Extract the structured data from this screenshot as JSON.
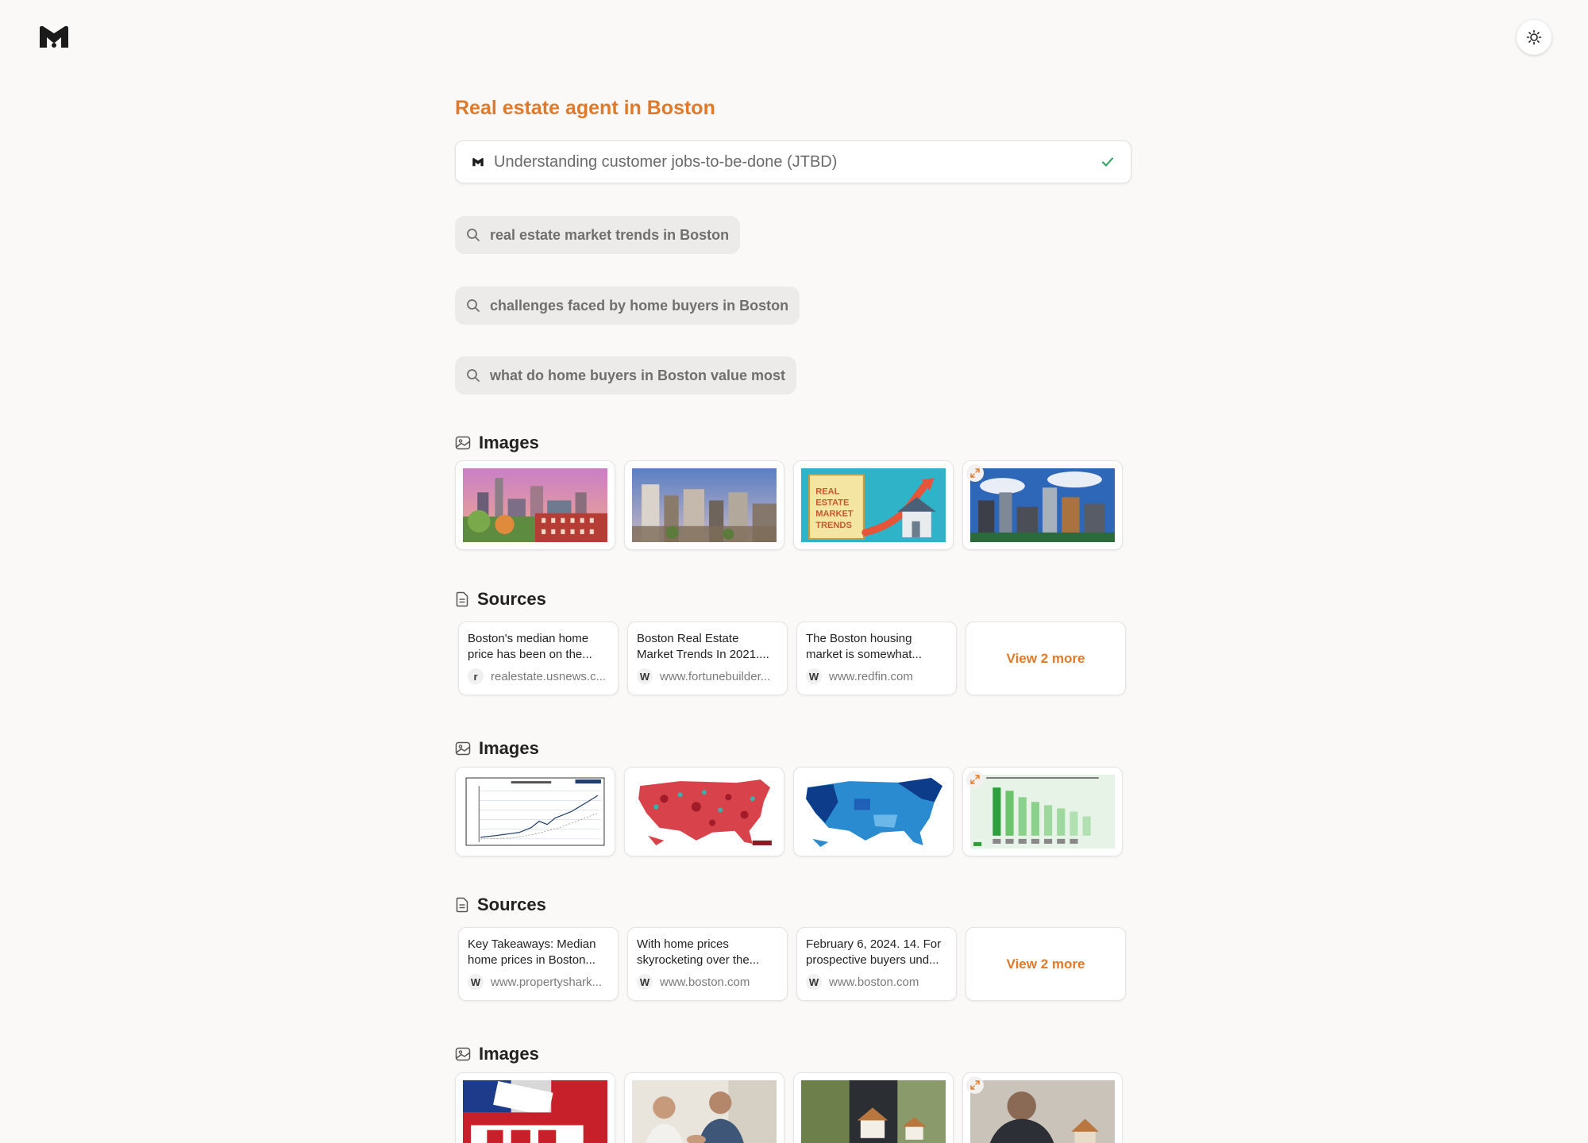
{
  "header": {
    "logo_icon": "m-logo-icon",
    "theme_toggle_icon": "sun-icon"
  },
  "query": {
    "title": "Real estate agent in Boston"
  },
  "task": {
    "label": "Understanding customer jobs-to-be-done (JTBD)",
    "status_icon": "check-icon",
    "accent": "#27a05a"
  },
  "searches": [
    "real estate market trends in Boston",
    "challenges faced by home buyers in Boston",
    "what do home buyers in Boston value most"
  ],
  "sections": {
    "images_label": "Images",
    "sources_label": "Sources"
  },
  "image_groups": [
    {
      "images": [
        "boston-skyline-sunset",
        "boston-aerial-city",
        "real-estate-market-trends-graphic",
        "boston-skyline-clouds"
      ],
      "thumb_texts": [
        "REAL",
        "ESTATE",
        "MARKET",
        "TRENDS"
      ]
    },
    {
      "images": [
        "home-price-line-chart",
        "red-us-map",
        "blue-us-map",
        "green-bar-chart"
      ]
    },
    {
      "images": [
        "sold-for-sale-sign",
        "agent-handshake",
        "hands-holding-house",
        "buyer-thinking-house"
      ]
    }
  ],
  "source_groups": [
    {
      "items": [
        {
          "snippet": "Boston's median home price has been on the...",
          "favicon": "r",
          "domain": "realestate.usnews.c..."
        },
        {
          "snippet": "Boston Real Estate Market Trends In 2021....",
          "favicon": "W",
          "domain": "www.fortunebuilder..."
        },
        {
          "snippet": "The Boston housing market is somewhat...",
          "favicon": "W",
          "domain": "www.redfin.com"
        }
      ],
      "more_label": "View 2 more"
    },
    {
      "items": [
        {
          "snippet": "Key Takeaways: Median home prices in Boston...",
          "favicon": "W",
          "domain": "www.propertyshark..."
        },
        {
          "snippet": "With home prices skyrocketing over the...",
          "favicon": "W",
          "domain": "www.boston.com"
        },
        {
          "snippet": "February 6, 2024. 14. For prospective buyers und...",
          "favicon": "W",
          "domain": "www.boston.com"
        }
      ],
      "more_label": "View 2 more"
    }
  ],
  "colors": {
    "accent": "#e07a2a",
    "background": "#faf9f8",
    "pill": "#ecebea"
  }
}
